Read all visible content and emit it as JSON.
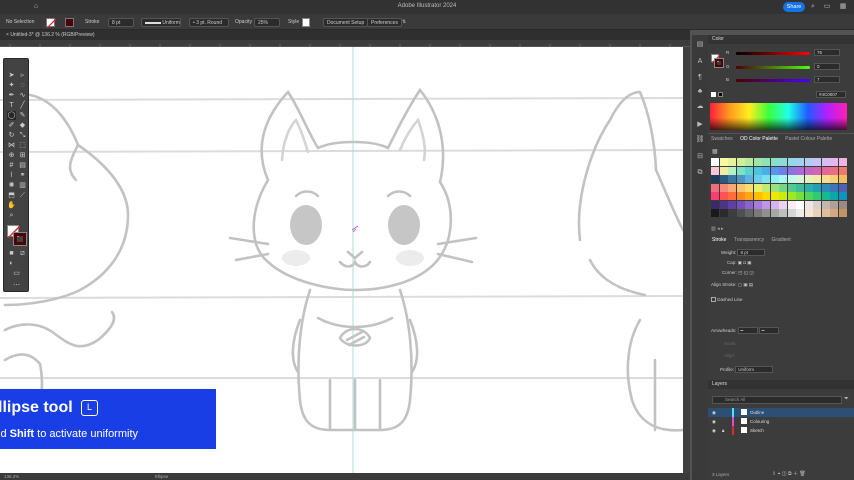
{
  "app": {
    "title": "Adobe Illustrator 2024",
    "share_label": "Share",
    "document_tab": "Untitled-3* @ 136.2 % (RGB/Preview)"
  },
  "control_bar": {
    "selection": "No Selection",
    "stroke_label": "Stroke",
    "stroke_weight": "8 pt",
    "profile": "Uniform",
    "brush": "3 pt. Round",
    "opacity_label": "Opacity",
    "opacity_value": "25%",
    "style_label": "Style",
    "doc_setup": "Document Setup",
    "preferences": "Preferences"
  },
  "status_bar": {
    "zoom": "136.2%",
    "tool": "Ellipse"
  },
  "color_panel": {
    "title": "Color",
    "r_label": "R",
    "g_label": "G",
    "b_label": "B",
    "r_value": "76",
    "g_value": "0",
    "b_value": "7",
    "hex": "4C0007",
    "hex_prefix": "#"
  },
  "swatch_tabs": {
    "tab1": "Swatches",
    "tab2": "OD Color Palette",
    "tab3": "Pastel Colour Palette"
  },
  "stroke_panel": {
    "tab1": "Stroke",
    "tab2": "Transparency",
    "tab3": "Gradient",
    "weight_label": "Weight:",
    "weight_value": "8 pt",
    "cap_label": "Cap:",
    "corner_label": "Corner:",
    "align_label": "Align Stroke:",
    "dashed_label": "Dashed Line",
    "arrowheads_label": "Arrowheads:",
    "scale_label": "Scale:",
    "align2_label": "Align:",
    "profile_label": "Profile:",
    "profile_value": "Uniform"
  },
  "layers_panel": {
    "title": "Layers",
    "search_placeholder": "Search All",
    "layers": [
      "Outline",
      "Colouring",
      "Sketch"
    ],
    "footer": "3 Layers"
  },
  "tooltip": {
    "tool_name": "llipse tool",
    "shortcut": "L",
    "hint_prefix": "ld ",
    "hint_key": "Shift",
    "hint_suffix": " to activate uniformity"
  },
  "colors": {
    "accent": "#1473e6",
    "tooltip_bg": "#1a3ee6",
    "selected_layer": "#2d4f73",
    "current_color": "#4C0007"
  },
  "swatches": [
    "#ffffff",
    "#f9f6a6",
    "#e7f39a",
    "#cfef9b",
    "#b7ea9f",
    "#9fe5a6",
    "#8ee2b5",
    "#8adfc8",
    "#8bdcd9",
    "#92d8e7",
    "#a1d3f1",
    "#b3ccf6",
    "#c5c4f6",
    "#d6bdf3",
    "#e5b7ec",
    "#f1b3e1",
    "#f7c8d8",
    "#f4e9a0",
    "#b7f0c5",
    "#7ee0c5",
    "#5bd3d2",
    "#4dc3e0",
    "#4aaee8",
    "#5a95ec",
    "#6f7fe9",
    "#8c72e3",
    "#a86ad8",
    "#c165c8",
    "#d564b3",
    "#e2679a",
    "#e96e81",
    "#eb7a6d",
    "#1a3d5c",
    "#2b5a80",
    "#3a78a3",
    "#4a97c4",
    "#5ab5de",
    "#6bcdec",
    "#7be0f2",
    "#8df0f5",
    "#a7f8f0",
    "#c3fae9",
    "#d7f7d4",
    "#e6f2bd",
    "#f0eaa4",
    "#f5de8c",
    "#f6d076",
    "#f3be63",
    "#f06b7f",
    "#f58a7a",
    "#f8a874",
    "#fac470",
    "#fbdc6c",
    "#e8ef6d",
    "#c3ea72",
    "#9be27a",
    "#76d783",
    "#55ca8f",
    "#3cbc9b",
    "#2bb0a8",
    "#239fb2",
    "#2a8cb7",
    "#3a77b6",
    "#4d63b1",
    "#ff3b6f",
    "#ff5252",
    "#ff6e3a",
    "#ff8a24",
    "#ffa512",
    "#ffbe06",
    "#ffd500",
    "#f0e700",
    "#c9eb10",
    "#9fe826",
    "#75e13f",
    "#4fd65a",
    "#30c976",
    "#18b991",
    "#0aa8aa",
    "#0a96c0",
    "#3b2a6b",
    "#4c3587",
    "#5e40a3",
    "#7350bb",
    "#8b63cd",
    "#a57bdb",
    "#bf96e5",
    "#d7b3ec",
    "#ebd1f2",
    "#f8ecf7",
    "#ffffff",
    "#ede6e4",
    "#d9cfcb",
    "#c4b7b2",
    "#b0a099",
    "#9c8a82",
    "#1a1a1a",
    "#2b2b2b",
    "#3d3d3d",
    "#505050",
    "#646464",
    "#7a7a7a",
    "#909090",
    "#a7a7a7",
    "#bfbfbf",
    "#d6d6d6",
    "#ececec",
    "#f5e6d7",
    "#ecd2b8",
    "#e0bd9b",
    "#d3a87f",
    "#c39465"
  ]
}
